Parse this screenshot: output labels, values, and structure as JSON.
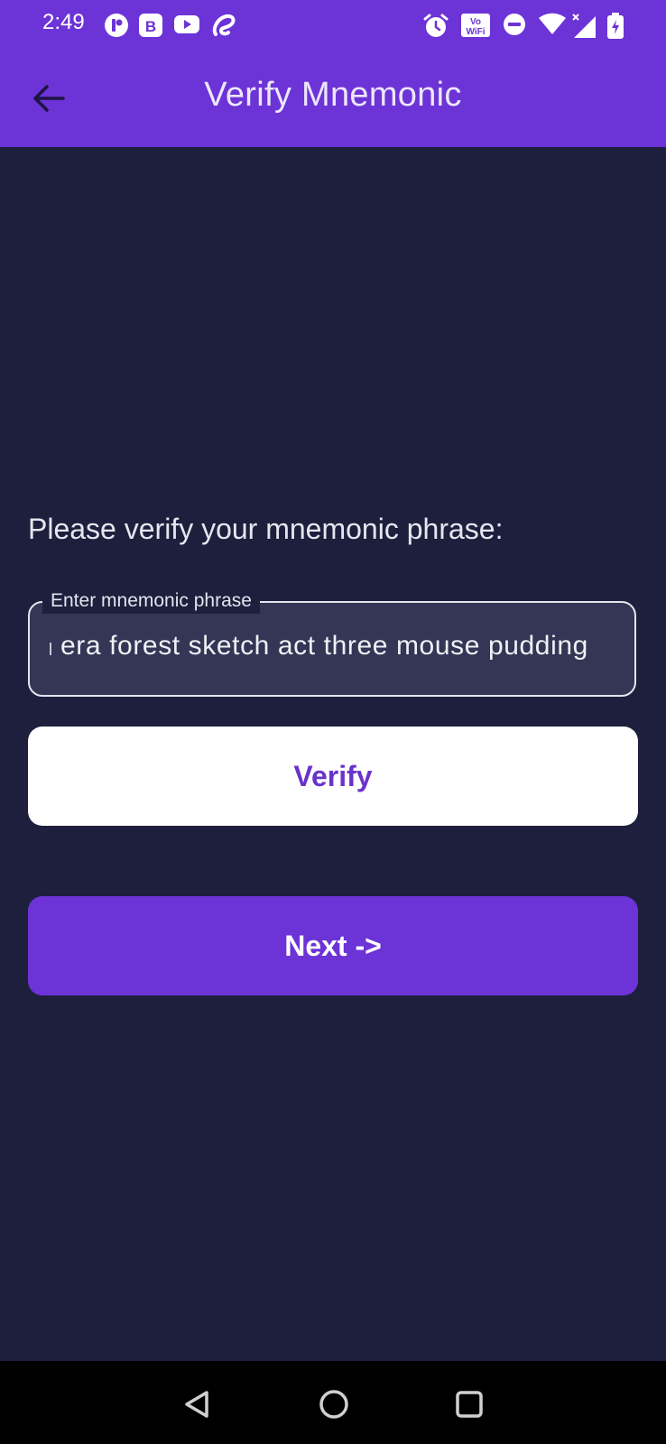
{
  "status_bar": {
    "time": "2:49",
    "left_icons": [
      "notification-app-icon",
      "b-app-icon",
      "youtube-icon",
      "airtel-icon"
    ],
    "right_icons": [
      "alarm-icon",
      "vowifi-icon",
      "dnd-icon",
      "wifi-icon",
      "signal-icon",
      "battery-icon"
    ],
    "vowifi_text": "Vo WiFi",
    "b_letter": "B"
  },
  "app_bar": {
    "title": "Verify Mnemonic",
    "back_icon": "arrow-left-icon",
    "background": "#6c33d6"
  },
  "main": {
    "prompt": "Please verify your mnemonic phrase:",
    "mnemonic_field": {
      "label": "Enter mnemonic phrase",
      "value": "era forest sketch act three mouse pudding"
    },
    "verify_button": {
      "label": "Verify"
    },
    "next_button": {
      "label": "Next ->"
    }
  },
  "nav_bar": {
    "icons": [
      "nav-back-icon",
      "nav-home-icon",
      "nav-recents-icon"
    ]
  },
  "colors": {
    "background": "#1d1f3d",
    "accent": "#6c33d6",
    "field_fill": "#333654",
    "button_text": "#6a33c9"
  }
}
